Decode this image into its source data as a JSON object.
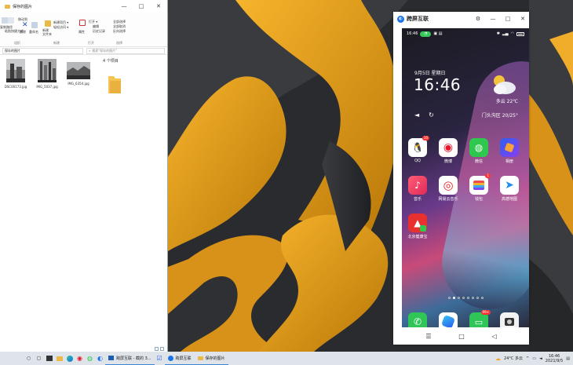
{
  "explorer": {
    "title": "保存的图片",
    "window_controls": [
      "—",
      "□",
      "✕"
    ],
    "ribbon": {
      "home_items": [
        "复制路径",
        "粘贴快捷方式"
      ],
      "org_items": [
        "移动到",
        "删除",
        "重命名"
      ],
      "new_items": [
        "新建项目 ▾",
        "轻松访问 ▾",
        "新建\n文件夹"
      ],
      "open_items": [
        "打开 ▾",
        "编辑",
        "历史记录"
      ],
      "prop_label": "属性",
      "select_items": [
        "全部选择",
        "全部取消",
        "反向选择"
      ],
      "groups": [
        "组织",
        "新建",
        "打开",
        "选择"
      ]
    },
    "address": "保存的图片",
    "search_placeholder": "搜索\"保存的图片\"",
    "item_count": "4 个项目",
    "files": [
      {
        "name": "DSC00173.jpg"
      },
      {
        "name": "IMG_5037.jpg"
      },
      {
        "name": "IMG_6354.jpg"
      }
    ]
  },
  "phone_window": {
    "app_name": "跨屏互联",
    "controls": [
      "⚙",
      "—",
      "□",
      "✕"
    ],
    "status": {
      "time": "16:46",
      "battery": "75"
    },
    "lock": {
      "date": "9月5日  星期日",
      "time": "16:46",
      "weather": "多云 22℃",
      "location": "门头沟区 20/25°"
    },
    "apps_row1": [
      {
        "label": "QQ",
        "badge": "10",
        "color": "#ffffff",
        "glyph": "🐧"
      },
      {
        "label": "微博",
        "badge": "",
        "color": "#ffffff",
        "glyph": "◉"
      },
      {
        "label": "微信",
        "badge": "",
        "color": "#2dc84d",
        "glyph": "💬"
      },
      {
        "label": "相册",
        "badge": "",
        "color": "#3a7bf2",
        "glyph": "◆"
      }
    ],
    "apps_row2": [
      {
        "label": "音乐",
        "badge": "",
        "color": "#f0446a",
        "glyph": "♪"
      },
      {
        "label": "网易云音乐",
        "badge": "",
        "color": "#ffffff",
        "glyph": "◎"
      },
      {
        "label": "钱包",
        "badge": "1",
        "color": "#ffffff",
        "glyph": "▤"
      },
      {
        "label": "高德地图",
        "badge": "",
        "color": "#ffffff",
        "glyph": "➤"
      }
    ],
    "apps_row3": [
      {
        "label": "北京健康宝",
        "badge": "",
        "color": "#e8312e",
        "glyph": "▲"
      }
    ],
    "dock": [
      {
        "name": "phone",
        "color": "#2fc657",
        "glyph": "✆"
      },
      {
        "name": "browser",
        "color": "#ffffff",
        "glyph": "◐"
      },
      {
        "name": "messages",
        "color": "#2fc657",
        "glyph": "✉",
        "badge": "99+"
      },
      {
        "name": "camera",
        "color": "#ffffff",
        "glyph": "◙"
      }
    ],
    "nav": [
      "☰",
      "□",
      "◁"
    ]
  },
  "taskbar": {
    "apps": [
      {
        "label": "跨屏互联 - 截的 3..."
      },
      {
        "label": "跨屏互联"
      },
      {
        "label": "保存的图片"
      }
    ],
    "tray": {
      "weather": "24°C  多云",
      "time": "16:46",
      "date": "2021/9/5"
    }
  },
  "colors": {
    "taskbar": "#dfe4ea",
    "accent": "#3a86d4"
  }
}
